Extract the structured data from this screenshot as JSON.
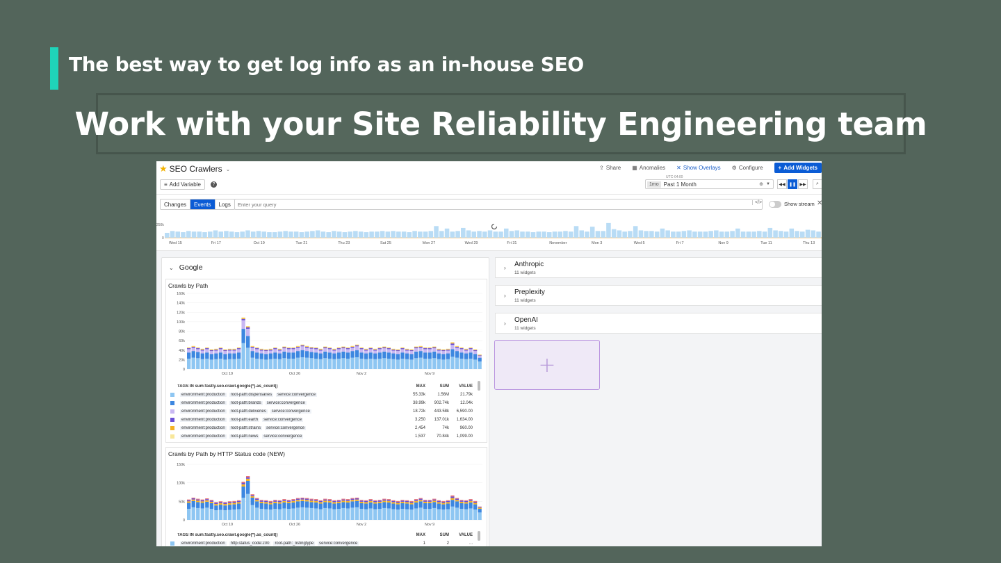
{
  "slide": {
    "subtitle": "The best way to get log info as an in-house SEO",
    "title": "Work with your Site Reliability Engineering team"
  },
  "colors": {
    "background": "#53655b",
    "accent": "#1fd3b9",
    "primary_blue": "#0b5cd5",
    "add_tile": "#efe9f7"
  },
  "dashboard": {
    "title": "SEO Crawlers",
    "actions": {
      "share": "Share",
      "anomalies": "Anomalies",
      "show_overlays": "Show Overlays",
      "configure": "Configure",
      "add_widgets": "Add Widgets"
    },
    "add_variable": "Add Variable",
    "timezone": "UTC-04:00",
    "time_badge": "1mo",
    "time_range": "Past 1 Month",
    "tabs": [
      "Changes",
      "Events",
      "Logs"
    ],
    "active_tab": "Events",
    "query_placeholder": "Enter your query",
    "show_stream": "Show stream"
  },
  "timeline": {
    "y_max_label": "250k",
    "y_zero_label": "0",
    "x_labels": [
      "Wed 15",
      "Fri 17",
      "Oct 19",
      "Tue 21",
      "Thu 23",
      "Sat 25",
      "Mon 27",
      "Wed 29",
      "Fri 31",
      "November",
      "Mon 3",
      "Wed 5",
      "Fri 7",
      "Nov 9",
      "Tue 11",
      "Thu 13"
    ],
    "values": [
      0.4,
      0.55,
      0.5,
      0.45,
      0.55,
      0.5,
      0.5,
      0.45,
      0.5,
      0.6,
      0.5,
      0.55,
      0.5,
      0.45,
      0.5,
      0.6,
      0.5,
      0.55,
      0.5,
      0.45,
      0.45,
      0.5,
      0.55,
      0.5,
      0.5,
      0.45,
      0.5,
      0.55,
      0.6,
      0.5,
      0.45,
      0.55,
      0.5,
      0.45,
      0.5,
      0.55,
      0.5,
      0.45,
      0.5,
      0.5,
      0.55,
      0.5,
      0.55,
      0.5,
      0.5,
      0.45,
      0.55,
      0.5,
      0.5,
      0.55,
      0.95,
      0.55,
      0.75,
      0.5,
      0.55,
      0.8,
      0.6,
      0.5,
      0.55,
      0.5,
      0.6,
      0.5,
      0.5,
      0.75,
      0.55,
      0.6,
      0.5,
      0.5,
      0.45,
      0.5,
      0.5,
      0.45,
      0.5,
      0.5,
      0.55,
      0.5,
      0.95,
      0.6,
      0.5,
      0.9,
      0.55,
      0.55,
      1.2,
      0.7,
      0.6,
      0.5,
      0.55,
      0.95,
      0.6,
      0.55,
      0.55,
      0.5,
      0.75,
      0.6,
      0.5,
      0.5,
      0.55,
      0.6,
      0.5,
      0.5,
      0.5,
      0.55,
      0.6,
      0.5,
      0.5,
      0.55,
      0.75,
      0.5,
      0.5,
      0.5,
      0.55,
      0.5,
      0.8,
      0.6,
      0.55,
      0.5,
      0.75,
      0.55,
      0.5,
      0.65,
      0.6,
      0.5
    ]
  },
  "groups": {
    "google": {
      "title": "Google",
      "widgets": [
        {
          "title": "Crawls by Path",
          "y_ticks": [
            "160k",
            "140k",
            "120k",
            "100k",
            "80k",
            "60k",
            "40k",
            "20k",
            "0"
          ],
          "x_labels": [
            "Oct 19",
            "Oct 26",
            "Nov 2",
            "Nov 9"
          ],
          "legend_header": {
            "tags": "TAGS IN sum:fastly.seo.crawl.google{*}.as_count()",
            "max": "MAX",
            "sum": "SUM",
            "value": "VALUE"
          },
          "legend_rows": [
            {
              "color": "#8ec6f2",
              "env": "environment:production",
              "path": "root-path:dispensaries",
              "service": "service:convergence",
              "max": "55.33k",
              "sum": "1.56M",
              "value": "21.79k"
            },
            {
              "color": "#3d87e0",
              "env": "environment:production",
              "path": "root-path:brands",
              "service": "service:convergence",
              "max": "38.99k",
              "sum": "902.74k",
              "value": "12.04k"
            },
            {
              "color": "#c9b8f2",
              "env": "environment:production",
              "path": "root-path:deliveries",
              "service": "service:convergence",
              "max": "18.72k",
              "sum": "443.58k",
              "value": "6,590.00"
            },
            {
              "color": "#6a4fd6",
              "env": "environment:production",
              "path": "root-path:earth",
              "service": "service:convergence",
              "max": "3,250",
              "sum": "137.01k",
              "value": "1,634.00"
            },
            {
              "color": "#f5b324",
              "env": "environment:production",
              "path": "root-path:strains",
              "service": "service:convergence",
              "max": "2,454",
              "sum": "74k",
              "value": "960.00"
            },
            {
              "color": "#f8e79a",
              "env": "environment:production",
              "path": "root-path:news",
              "service": "service:convergence",
              "max": "1,537",
              "sum": "70.84k",
              "value": "1,099.00"
            }
          ]
        },
        {
          "title": "Crawls by Path by HTTP Status code (NEW)",
          "y_ticks": [
            "150k",
            "100k",
            "50k",
            "0"
          ],
          "x_labels": [
            "Oct 19",
            "Oct 26",
            "Nov 2",
            "Nov 9"
          ],
          "legend_header": {
            "tags": "TAGS IN sum:fastly.seo.crawl.google{*}.as_count()",
            "max": "MAX",
            "sum": "SUM",
            "value": "VALUE"
          },
          "legend_rows": [
            {
              "color": "#8ec6f2",
              "env": "environment:production",
              "path": "http.status_code:200",
              "service": "root-path:_listingtype",
              "extra": "service:convergence",
              "max": "1",
              "sum": "2",
              "value": "..."
            }
          ]
        }
      ]
    },
    "side": [
      {
        "title": "Anthropic",
        "sub": "11 widgets"
      },
      {
        "title": "Preplexity",
        "sub": "11 widgets"
      },
      {
        "title": "OpenAI",
        "sub": "11 widgets"
      }
    ]
  },
  "chart_data": [
    {
      "type": "bar",
      "title": "Crawls by Path",
      "stacked": true,
      "ylim": [
        0,
        160000
      ],
      "x_labels": [
        "Oct 19",
        "Oct 26",
        "Nov 2",
        "Nov 9"
      ],
      "series": [
        {
          "name": "environment:production root-path:dispensaries service:convergence",
          "color": "#8ec6f2",
          "values": [
            22,
            24,
            23,
            21,
            22,
            20,
            21,
            22,
            20,
            21,
            21,
            22,
            55,
            45,
            24,
            22,
            21,
            20,
            21,
            22,
            21,
            23,
            22,
            22,
            24,
            25,
            24,
            23,
            22,
            21,
            23,
            22,
            21,
            22,
            23,
            22,
            24,
            25,
            22,
            21,
            22,
            21,
            22,
            23,
            22,
            21,
            20,
            22,
            21,
            20,
            23,
            24,
            22,
            22,
            23,
            21,
            20,
            21,
            26,
            24,
            22,
            21,
            22,
            20,
            16
          ]
        },
        {
          "name": "environment:production root-path:brands service:convergence",
          "color": "#3d87e0",
          "values": [
            13,
            14,
            13,
            12,
            13,
            12,
            12,
            13,
            12,
            12,
            12,
            13,
            30,
            25,
            14,
            13,
            12,
            12,
            12,
            13,
            12,
            14,
            13,
            13,
            14,
            15,
            14,
            13,
            13,
            12,
            14,
            13,
            12,
            13,
            14,
            13,
            14,
            15,
            13,
            12,
            13,
            12,
            13,
            14,
            13,
            12,
            12,
            13,
            12,
            12,
            14,
            14,
            13,
            13,
            14,
            12,
            12,
            12,
            16,
            14,
            13,
            12,
            13,
            12,
            8
          ]
        },
        {
          "name": "environment:production root-path:deliveries service:convergence",
          "color": "#c9b8f2",
          "values": [
            7,
            7,
            6,
            6,
            7,
            6,
            6,
            7,
            6,
            6,
            6,
            7,
            18,
            15,
            7,
            7,
            6,
            6,
            6,
            7,
            6,
            7,
            7,
            7,
            7,
            8,
            7,
            7,
            7,
            6,
            7,
            7,
            6,
            7,
            7,
            7,
            7,
            8,
            7,
            6,
            7,
            6,
            7,
            7,
            7,
            6,
            6,
            7,
            6,
            6,
            7,
            7,
            7,
            7,
            7,
            6,
            6,
            6,
            9,
            7,
            7,
            6,
            7,
            6,
            4
          ]
        },
        {
          "name": "environment:production root-path:earth service:convergence",
          "color": "#6a4fd6",
          "values": [
            2,
            2,
            2,
            2,
            2,
            2,
            2,
            2,
            2,
            2,
            2,
            2,
            3,
            3,
            2,
            2,
            2,
            2,
            2,
            2,
            2,
            2,
            2,
            2,
            2,
            2,
            2,
            2,
            2,
            2,
            2,
            2,
            2,
            2,
            2,
            2,
            2,
            2,
            2,
            2,
            2,
            2,
            2,
            2,
            2,
            2,
            2,
            2,
            2,
            2,
            2,
            2,
            2,
            2,
            2,
            2,
            2,
            2,
            3,
            2,
            2,
            2,
            2,
            2,
            1
          ]
        },
        {
          "name": "environment:production root-path:strains service:convergence",
          "color": "#f5b324",
          "values": [
            1,
            1,
            1,
            1,
            1,
            1,
            1,
            1,
            1,
            1,
            1,
            1,
            2,
            2,
            1,
            1,
            1,
            1,
            1,
            1,
            1,
            1,
            1,
            1,
            1,
            1,
            1,
            1,
            1,
            1,
            1,
            1,
            1,
            1,
            1,
            1,
            1,
            1,
            1,
            1,
            1,
            1,
            1,
            1,
            1,
            1,
            1,
            1,
            1,
            1,
            1,
            1,
            1,
            1,
            1,
            1,
            1,
            1,
            2,
            1,
            1,
            1,
            1,
            1,
            1
          ]
        },
        {
          "name": "environment:production root-path:news service:convergence",
          "color": "#f8e79a",
          "values": [
            1,
            1,
            1,
            1,
            1,
            1,
            1,
            1,
            1,
            1,
            1,
            1,
            1,
            1,
            1,
            1,
            1,
            1,
            1,
            1,
            1,
            1,
            1,
            1,
            1,
            1,
            1,
            1,
            1,
            1,
            1,
            1,
            1,
            1,
            1,
            1,
            1,
            1,
            1,
            1,
            1,
            1,
            1,
            1,
            1,
            1,
            1,
            1,
            1,
            1,
            1,
            1,
            1,
            1,
            1,
            1,
            1,
            1,
            1,
            1,
            1,
            1,
            1,
            1,
            1
          ]
        }
      ]
    },
    {
      "type": "bar",
      "title": "Crawls by Path by HTTP Status code (NEW)",
      "stacked": true,
      "ylim": [
        0,
        150000
      ],
      "x_labels": [
        "Oct 19",
        "Oct 26",
        "Nov 2",
        "Nov 9"
      ],
      "series": [
        {
          "name": "environment:production http.status_code:200 root-path:_listingtype service:convergence",
          "color": "#8ec6f2",
          "values": [
            30,
            34,
            32,
            31,
            33,
            30,
            26,
            27,
            26,
            27,
            28,
            29,
            60,
            70,
            40,
            33,
            30,
            29,
            28,
            30,
            29,
            31,
            30,
            31,
            33,
            34,
            33,
            32,
            31,
            29,
            32,
            31,
            29,
            30,
            32,
            31,
            33,
            34,
            30,
            29,
            31,
            29,
            30,
            32,
            31,
            29,
            28,
            30,
            29,
            28,
            31,
            33,
            30,
            30,
            32,
            29,
            28,
            29,
            36,
            33,
            30,
            29,
            31,
            28,
            20
          ]
        },
        {
          "name": "",
          "color": "#3d87e0",
          "values": [
            16,
            17,
            16,
            15,
            16,
            15,
            13,
            14,
            13,
            14,
            14,
            15,
            30,
            35,
            20,
            17,
            15,
            15,
            14,
            15,
            15,
            16,
            15,
            16,
            17,
            17,
            17,
            16,
            16,
            15,
            16,
            16,
            15,
            15,
            16,
            16,
            17,
            17,
            15,
            15,
            16,
            15,
            15,
            16,
            16,
            15,
            14,
            15,
            15,
            14,
            16,
            17,
            15,
            15,
            16,
            15,
            14,
            15,
            18,
            17,
            15,
            15,
            16,
            14,
            10
          ]
        },
        {
          "name": "",
          "color": "#f5b324",
          "values": [
            4,
            4,
            4,
            4,
            4,
            4,
            4,
            4,
            4,
            4,
            4,
            4,
            6,
            6,
            4,
            4,
            4,
            4,
            4,
            4,
            4,
            4,
            4,
            4,
            4,
            4,
            4,
            4,
            4,
            4,
            4,
            4,
            4,
            4,
            4,
            4,
            4,
            4,
            4,
            4,
            4,
            4,
            4,
            4,
            4,
            4,
            4,
            4,
            4,
            4,
            4,
            4,
            4,
            4,
            4,
            4,
            4,
            4,
            5,
            4,
            4,
            4,
            4,
            4,
            3
          ]
        },
        {
          "name": "",
          "color": "#6a4fd6",
          "values": [
            3,
            3,
            3,
            3,
            3,
            3,
            3,
            3,
            3,
            3,
            3,
            3,
            4,
            4,
            3,
            3,
            3,
            3,
            3,
            3,
            3,
            3,
            3,
            3,
            3,
            3,
            3,
            3,
            3,
            3,
            3,
            3,
            3,
            3,
            3,
            3,
            3,
            3,
            3,
            3,
            3,
            3,
            3,
            3,
            3,
            3,
            3,
            3,
            3,
            3,
            3,
            3,
            3,
            3,
            3,
            3,
            3,
            3,
            4,
            3,
            3,
            3,
            3,
            3,
            2
          ]
        },
        {
          "name": "",
          "color": "#e86b6b",
          "values": [
            2,
            2,
            2,
            2,
            2,
            2,
            2,
            2,
            2,
            2,
            2,
            2,
            3,
            3,
            2,
            2,
            2,
            2,
            2,
            2,
            2,
            2,
            2,
            2,
            2,
            2,
            2,
            2,
            2,
            2,
            2,
            2,
            2,
            2,
            2,
            2,
            2,
            2,
            2,
            2,
            2,
            2,
            2,
            2,
            2,
            2,
            2,
            2,
            2,
            2,
            2,
            2,
            2,
            2,
            2,
            2,
            2,
            2,
            3,
            2,
            2,
            2,
            2,
            2,
            1
          ]
        }
      ]
    }
  ]
}
